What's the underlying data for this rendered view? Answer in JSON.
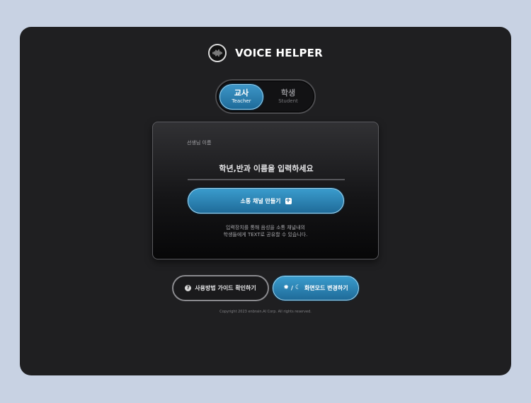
{
  "header": {
    "logo_icon": "voice-waveform-icon",
    "title": "VOICE HELPER"
  },
  "role_toggle": {
    "teacher": {
      "label_ko": "교사",
      "label_en": "Teacher",
      "selected": true
    },
    "student": {
      "label_ko": "학생",
      "label_en": "Student",
      "selected": false
    }
  },
  "card": {
    "label": "선생님 이름",
    "input_value": "",
    "input_placeholder": "학년,반과 이름을 입력하세요",
    "create_button_label": "소통 채널 만들기",
    "create_button_icon": "plus-square-icon",
    "description_line1": "입력장치를 통해 음성을 소통 채널내의",
    "description_line2": "학생들에게 TEXT로 공유할 수 있습니다."
  },
  "footer_buttons": {
    "guide_label": "사용방법 가이드 확인하기",
    "guide_icon": "question-circle-icon",
    "theme_label": "화면모드 변경하기",
    "theme_icons": [
      "sun-icon",
      "moon-icon"
    ],
    "theme_separator": "/"
  },
  "copyright": "Copyright 2023 enbrain.AI Corp. All rights reserved.",
  "colors": {
    "page_background": "#c8d2e3",
    "app_background": "#1f1f21",
    "accent_blue": "#2f86b8",
    "accent_border": "#a8d8f0"
  }
}
